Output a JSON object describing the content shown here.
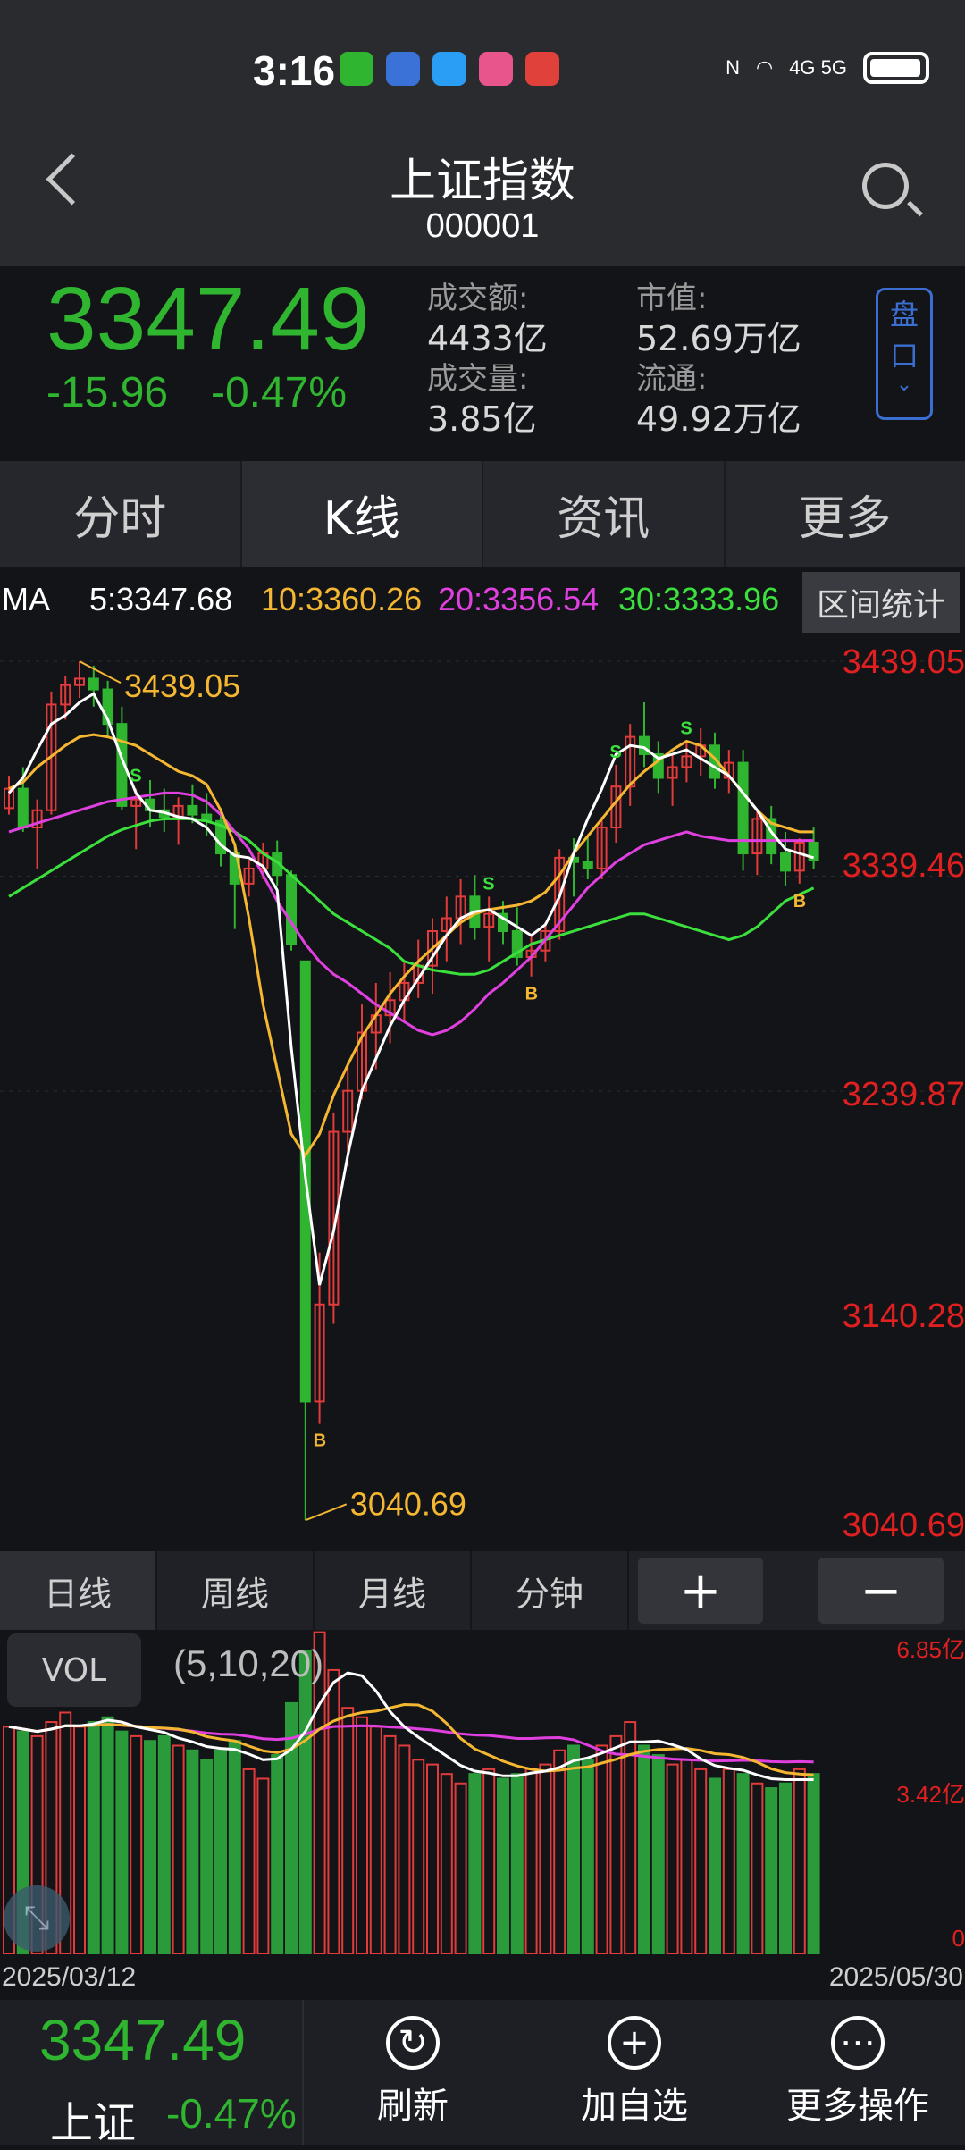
{
  "status_bar": {
    "time": "3:16",
    "network": "4G  5G"
  },
  "header": {
    "title": "上证指数",
    "code": "000001"
  },
  "quote": {
    "price": "3347.49",
    "change": "-15.96",
    "change_pct": "-0.47%",
    "turnover_label": "成交额:",
    "turnover": "4433亿",
    "volume_label": "成交量:",
    "volume": "3.85亿",
    "mktcap_label": "市值:",
    "mktcap": "52.69万亿",
    "float_label": "流通:",
    "float": "49.92万亿",
    "pankou": "盘口"
  },
  "tabs": [
    {
      "label": "分时"
    },
    {
      "label": "K线"
    },
    {
      "label": "资讯"
    },
    {
      "label": "更多"
    }
  ],
  "ma": {
    "label": "MA",
    "ma5": "5:3347.68",
    "ma10": "10:3360.26",
    "ma20": "20:3356.54",
    "ma30": "30:3333.96",
    "range_btn": "区间统计"
  },
  "chart_data": {
    "type": "candlestick",
    "high_label": "3439.05",
    "low_label": "3040.69",
    "y_ticks": [
      "3439.05",
      "3339.46",
      "3239.87",
      "3140.28",
      "3040.69"
    ],
    "ylim": [
      3040.69,
      3439.05
    ],
    "x_start": "2025/03/12",
    "x_end": "2025/05/30",
    "signals": [
      "S",
      "S",
      "B",
      "S",
      "B",
      "S",
      "B"
    ],
    "candles": [
      [
        3371,
        3386,
        3368,
        3380
      ],
      [
        3380,
        3390,
        3360,
        3362
      ],
      [
        3362,
        3375,
        3343,
        3370
      ],
      [
        3370,
        3425,
        3368,
        3419
      ],
      [
        3419,
        3432,
        3412,
        3428
      ],
      [
        3428,
        3439,
        3422,
        3431
      ],
      [
        3431,
        3437,
        3418,
        3426
      ],
      [
        3426,
        3430,
        3405,
        3410
      ],
      [
        3410,
        3418,
        3370,
        3372
      ],
      [
        3372,
        3380,
        3352,
        3375
      ],
      [
        3375,
        3384,
        3362,
        3370
      ],
      [
        3370,
        3380,
        3360,
        3367
      ],
      [
        3367,
        3376,
        3354,
        3372
      ],
      [
        3372,
        3382,
        3364,
        3368
      ],
      [
        3368,
        3378,
        3358,
        3365
      ],
      [
        3365,
        3371,
        3344,
        3350
      ],
      [
        3350,
        3355,
        3315,
        3336
      ],
      [
        3336,
        3347,
        3330,
        3343
      ],
      [
        3343,
        3355,
        3338,
        3350
      ],
      [
        3350,
        3356,
        3335,
        3340
      ],
      [
        3340,
        3342,
        3305,
        3308
      ],
      [
        3300,
        3300,
        3041,
        3096
      ],
      [
        3096,
        3165,
        3086,
        3141
      ],
      [
        3141,
        3230,
        3132,
        3221
      ],
      [
        3221,
        3253,
        3205,
        3240
      ],
      [
        3240,
        3280,
        3236,
        3267
      ],
      [
        3267,
        3290,
        3250,
        3275
      ],
      [
        3275,
        3295,
        3262,
        3282
      ],
      [
        3282,
        3300,
        3272,
        3290
      ],
      [
        3290,
        3310,
        3283,
        3298
      ],
      [
        3298,
        3320,
        3285,
        3314
      ],
      [
        3314,
        3330,
        3300,
        3320
      ],
      [
        3320,
        3338,
        3308,
        3330
      ],
      [
        3330,
        3340,
        3310,
        3316
      ],
      [
        3316,
        3330,
        3300,
        3322
      ],
      [
        3322,
        3328,
        3308,
        3314
      ],
      [
        3314,
        3325,
        3298,
        3302
      ],
      [
        3302,
        3312,
        3293,
        3305
      ],
      [
        3305,
        3318,
        3300,
        3314
      ],
      [
        3314,
        3352,
        3310,
        3348
      ],
      [
        3348,
        3357,
        3330,
        3346
      ],
      [
        3346,
        3358,
        3338,
        3343
      ],
      [
        3343,
        3367,
        3338,
        3362
      ],
      [
        3362,
        3391,
        3355,
        3381
      ],
      [
        3381,
        3410,
        3372,
        3404
      ],
      [
        3404,
        3420,
        3390,
        3396
      ],
      [
        3396,
        3402,
        3378,
        3385
      ],
      [
        3385,
        3396,
        3372,
        3390
      ],
      [
        3390,
        3402,
        3383,
        3395
      ],
      [
        3395,
        3408,
        3386,
        3400
      ],
      [
        3400,
        3406,
        3380,
        3385
      ],
      [
        3385,
        3398,
        3378,
        3392
      ],
      [
        3392,
        3398,
        3342,
        3350
      ],
      [
        3350,
        3370,
        3340,
        3366
      ],
      [
        3366,
        3372,
        3345,
        3350
      ],
      [
        3350,
        3360,
        3335,
        3342
      ],
      [
        3342,
        3357,
        3336,
        3355
      ],
      [
        3355,
        3362,
        3343,
        3347
      ]
    ],
    "ma5": [
      3378,
      3385,
      3398,
      3410,
      3414,
      3420,
      3424,
      3412,
      3394,
      3378,
      3370,
      3369,
      3367,
      3366,
      3362,
      3354,
      3349,
      3348,
      3344,
      3333,
      3260,
      3200,
      3150,
      3175,
      3210,
      3240,
      3255,
      3270,
      3282,
      3292,
      3302,
      3312,
      3320,
      3323,
      3324,
      3320,
      3316,
      3312,
      3317,
      3330,
      3350,
      3366,
      3380,
      3396,
      3400,
      3399,
      3394,
      3396,
      3398,
      3394,
      3390,
      3386,
      3378,
      3370,
      3360,
      3352,
      3350,
      3348
    ],
    "ma10": [
      3380,
      3383,
      3390,
      3395,
      3400,
      3404,
      3405,
      3404,
      3402,
      3400,
      3396,
      3392,
      3388,
      3386,
      3382,
      3370,
      3354,
      3320,
      3280,
      3250,
      3220,
      3210,
      3220,
      3238,
      3252,
      3265,
      3275,
      3285,
      3293,
      3300,
      3306,
      3312,
      3318,
      3322,
      3324,
      3325,
      3326,
      3328,
      3332,
      3340,
      3350,
      3358,
      3366,
      3374,
      3382,
      3388,
      3393,
      3398,
      3402,
      3400,
      3394,
      3386,
      3378,
      3370,
      3364,
      3362,
      3360,
      3360
    ],
    "ma20": [
      3360,
      3362,
      3364,
      3366,
      3368,
      3370,
      3372,
      3374,
      3375,
      3376,
      3377,
      3378,
      3378,
      3377,
      3374,
      3368,
      3360,
      3352,
      3340,
      3328,
      3318,
      3308,
      3300,
      3294,
      3290,
      3285,
      3280,
      3276,
      3272,
      3268,
      3266,
      3268,
      3272,
      3278,
      3285,
      3290,
      3296,
      3302,
      3310,
      3318,
      3326,
      3334,
      3340,
      3346,
      3350,
      3354,
      3356,
      3358,
      3360,
      3358,
      3357,
      3356,
      3356,
      3356,
      3356,
      3356,
      3356,
      3356
    ],
    "ma30": [
      3330,
      3334,
      3338,
      3342,
      3346,
      3350,
      3354,
      3358,
      3361,
      3363,
      3365,
      3366,
      3366,
      3366,
      3365,
      3363,
      3360,
      3356,
      3350,
      3346,
      3340,
      3334,
      3328,
      3322,
      3318,
      3314,
      3310,
      3306,
      3300,
      3298,
      3296,
      3295,
      3294,
      3294,
      3296,
      3300,
      3304,
      3308,
      3310,
      3312,
      3314,
      3316,
      3318,
      3320,
      3322,
      3322,
      3320,
      3318,
      3316,
      3314,
      3312,
      3310,
      3312,
      3316,
      3322,
      3328,
      3331,
      3334
    ],
    "vol_ticks": [
      "6.85亿",
      "3.42亿",
      "0"
    ],
    "vol_max": 6.85,
    "volumes": [
      4.8,
      4.7,
      4.6,
      4.9,
      5.1,
      4.8,
      4.9,
      5.0,
      4.7,
      4.6,
      4.5,
      4.6,
      4.4,
      4.3,
      4.1,
      4.3,
      4.5,
      3.9,
      3.7,
      4.2,
      5.3,
      6.4,
      6.8,
      6.0,
      5.2,
      5.0,
      4.8,
      4.6,
      4.4,
      4.1,
      4.0,
      3.8,
      3.6,
      3.8,
      3.9,
      3.7,
      3.8,
      3.9,
      4.0,
      4.3,
      4.4,
      4.1,
      4.4,
      4.6,
      4.9,
      4.4,
      4.2,
      4.0,
      4.1,
      3.9,
      3.7,
      3.9,
      3.8,
      3.6,
      3.5,
      3.6,
      3.9,
      3.8
    ]
  },
  "periods": [
    {
      "label": "日线"
    },
    {
      "label": "周线"
    },
    {
      "label": "月线"
    },
    {
      "label": "分钟"
    }
  ],
  "zoom": {
    "in": "+",
    "out": "−"
  },
  "volume": {
    "label": "VOL",
    "params": "(5,10,20)"
  },
  "dates": {
    "start": "2025/03/12",
    "end": "2025/05/30"
  },
  "footer": {
    "price": "3347.49",
    "name": "上证",
    "change_pct": "-0.47%",
    "refresh": "刷新",
    "add": "加自选",
    "more": "更多操作"
  }
}
